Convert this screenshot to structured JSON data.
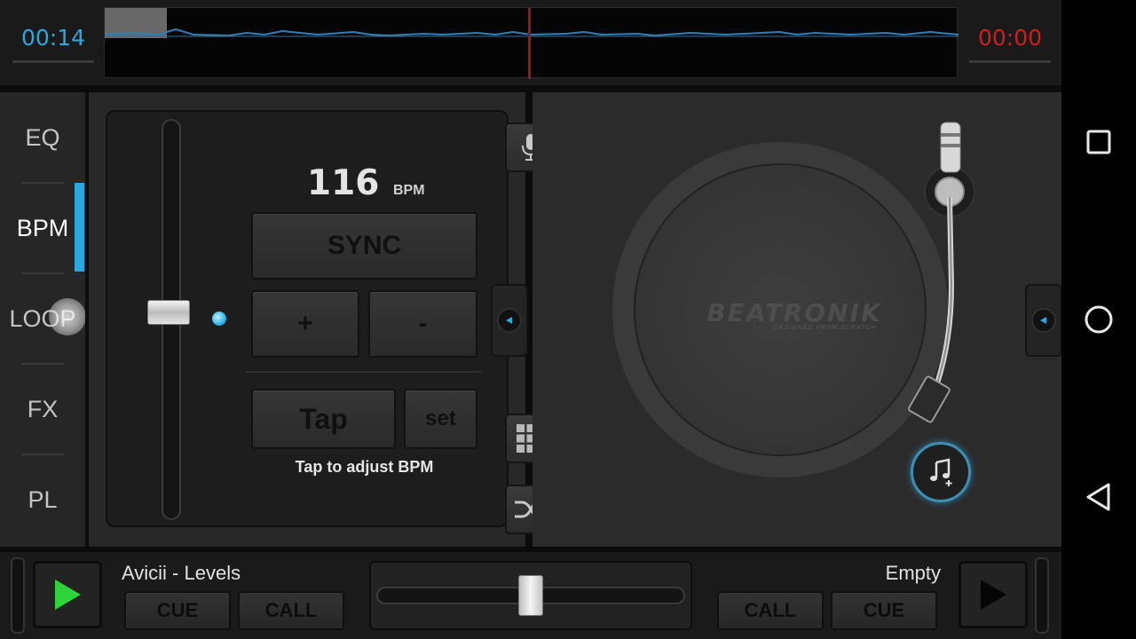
{
  "colors": {
    "accent": "#29a8e0",
    "time_left": "#29a8e0",
    "time_right": "#cc1f1f",
    "playhead": "#9a1515",
    "play_green": "#2fd43a",
    "waveform": "#2f7fb8"
  },
  "deck_left": {
    "elapsed_time": "00:14",
    "track_title": "Avicii - Levels",
    "cue_label": "CUE",
    "call_label": "CALL",
    "play_icon": "play-icon"
  },
  "deck_right": {
    "elapsed_time": "00:00",
    "track_title": "Empty",
    "cue_label": "CUE",
    "call_label": "CALL",
    "play_icon": "play-icon"
  },
  "tabs": [
    {
      "label": "EQ",
      "active": false
    },
    {
      "label": "BPM",
      "active": true
    },
    {
      "label": "LOOP",
      "active": false
    },
    {
      "label": "FX",
      "active": false
    },
    {
      "label": "PL",
      "active": false
    }
  ],
  "bpm_panel": {
    "bpm_value": "116",
    "bpm_unit": "BPM",
    "sync_label": "SYNC",
    "plus_label": "+",
    "minus_label": "-",
    "tap_label": "Tap",
    "set_label": "set",
    "hint": "Tap to adjust BPM",
    "pitch_level": 0.48
  },
  "turntable": {
    "logo_text": "BEATRONIK",
    "logo_sub": "DESIGNED FROM SCRATCH"
  },
  "crossfader": {
    "position": 0.5
  },
  "side_buttons": [
    "microphone-icon",
    "grid-icon",
    "shuffle-icon"
  ],
  "android_nav": [
    "recents-icon",
    "home-icon",
    "back-icon"
  ]
}
